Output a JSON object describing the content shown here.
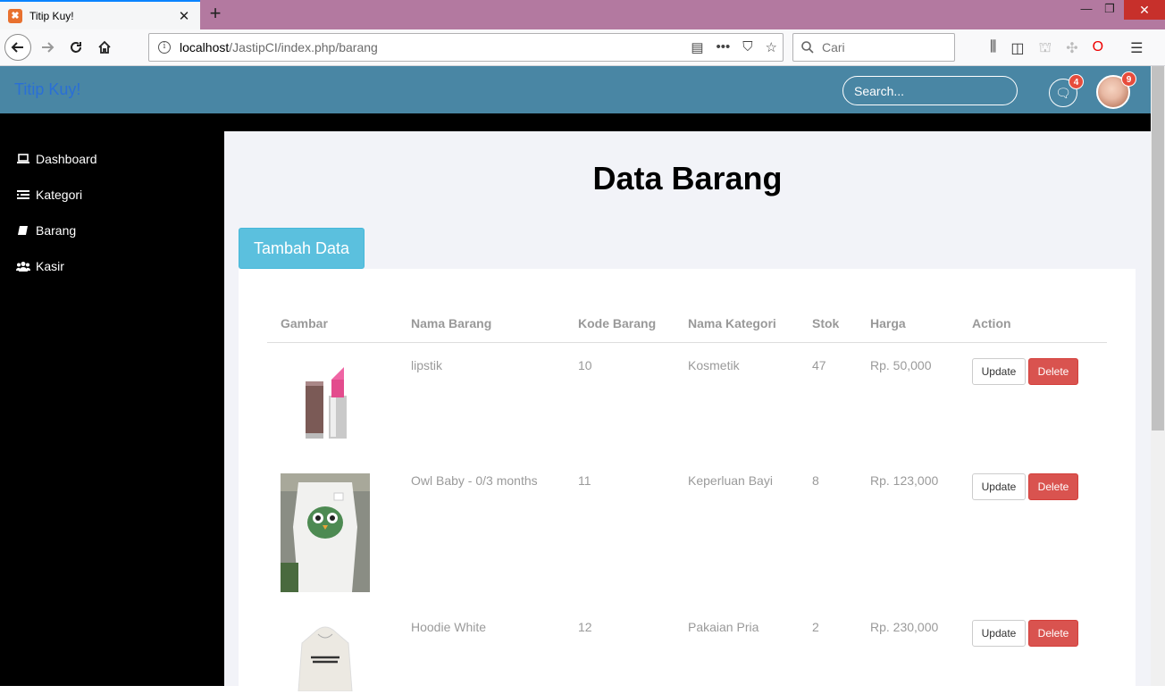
{
  "browser": {
    "tab_title": "Titip Kuy!",
    "tab_close": "✕",
    "new_tab": "+",
    "url_host": "localhost",
    "url_path": "/JastipCI/index.php/barang",
    "search_placeholder": "Cari",
    "accent": "#0a84ff"
  },
  "app": {
    "brand": "Titip Kuy!",
    "search_placeholder": "Search...",
    "chat_badge": "4",
    "avatar_badge": "9",
    "header_color": "#4986a4"
  },
  "sidebar": {
    "items": [
      {
        "label": "Dashboard",
        "icon": "laptop-icon"
      },
      {
        "label": "Kategori",
        "icon": "list-icon"
      },
      {
        "label": "Barang",
        "icon": "book-icon"
      },
      {
        "label": "Kasir",
        "icon": "users-icon"
      }
    ]
  },
  "main": {
    "title": "Data Barang",
    "add_button": "Tambah Data",
    "columns": [
      "Gambar",
      "Nama Barang",
      "Kode Barang",
      "Nama Kategori",
      "Stok",
      "Harga",
      "Action"
    ],
    "rows": [
      {
        "nama": "lipstik",
        "kode": "10",
        "kategori": "Kosmetik",
        "stok": "47",
        "harga": "Rp. 50,000",
        "update": "Update",
        "delete": "Delete"
      },
      {
        "nama": "Owl Baby - 0/3 months",
        "kode": "11",
        "kategori": "Keperluan Bayi",
        "stok": "8",
        "harga": "Rp. 123,000",
        "update": "Update",
        "delete": "Delete"
      },
      {
        "nama": "Hoodie White",
        "kode": "12",
        "kategori": "Pakaian Pria",
        "stok": "2",
        "harga": "Rp. 230,000",
        "update": "Update",
        "delete": "Delete"
      }
    ]
  }
}
